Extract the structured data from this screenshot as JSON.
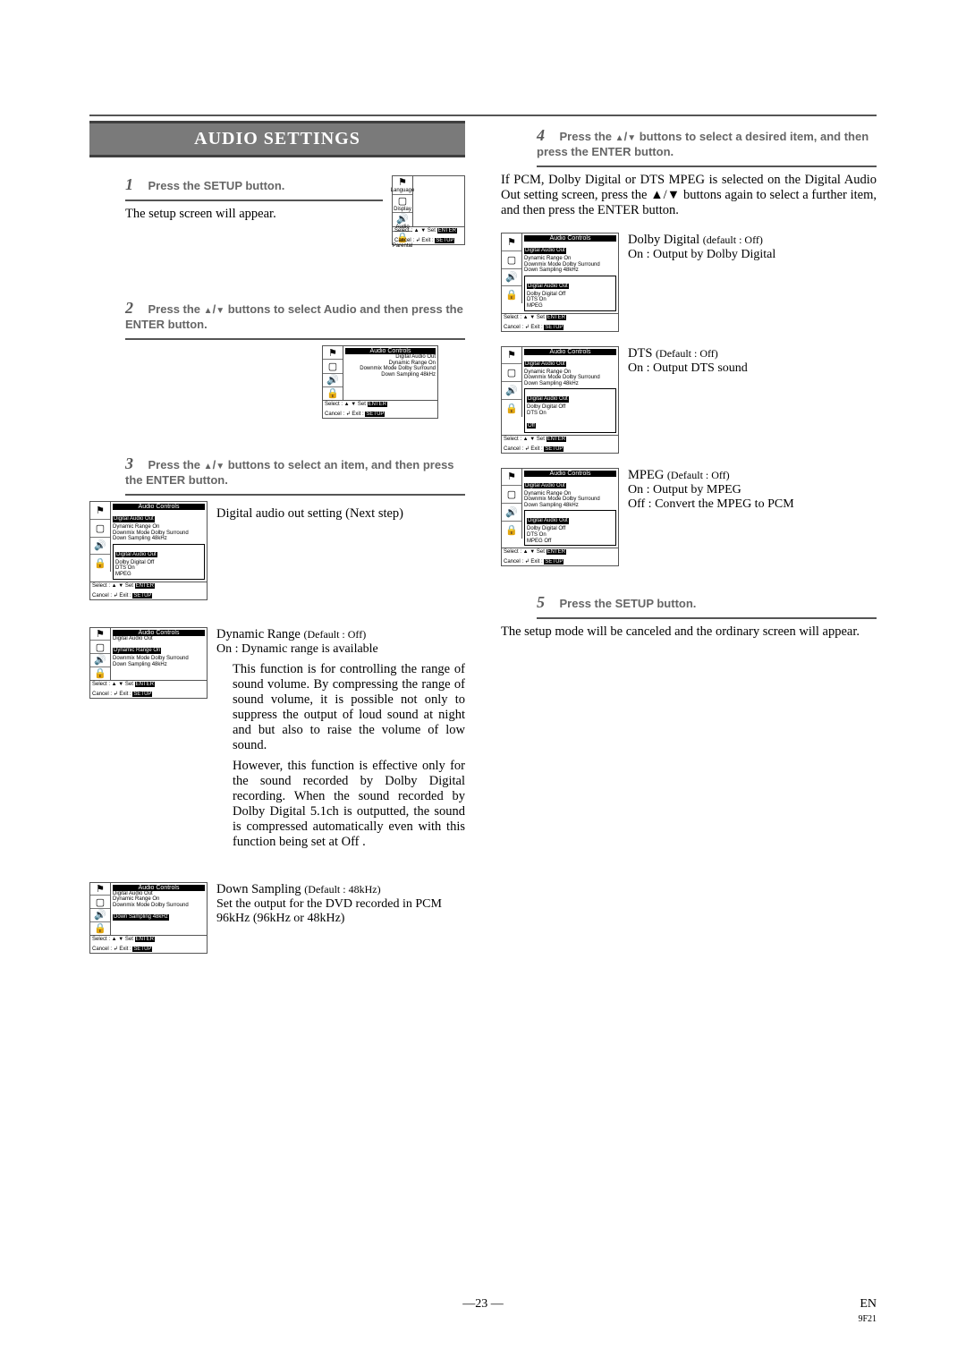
{
  "title": "AUDIO SETTINGS",
  "steps": {
    "s1": {
      "num": "1",
      "head": "Press the SETUP button.",
      "body": "The setup screen will appear."
    },
    "s2": {
      "num": "2",
      "head_a": "Press the ",
      "head_b": " buttons to select Audio and then press the ENTER button."
    },
    "s3": {
      "num": "3",
      "head_a": "Press the ",
      "head_b": " buttons to select an item, and then press the ENTER button.",
      "dao": "Digital audio out setting (Next step)",
      "dr_title": "Dynamic Range ",
      "dr_default": "(Default : Off)",
      "dr_line": "On : Dynamic range is available",
      "dr_p1": "This function is for controlling the range of sound volume.  By compressing the range of sound volume, it is possible not only to suppress the output of loud sound at night and but also to raise the volume of low sound.",
      "dr_p2": "However, this function is effective only for the sound recorded by Dolby Digital recording.  When the sound recorded by Dolby Digital 5.1ch is outputted, the sound is compressed automatically even with this function being set at  Off .",
      "ds_title": "Down Sampling ",
      "ds_default": "(Default : 48kHz)",
      "ds_line": "Set the output for the DVD recorded in PCM 96kHz (96kHz or 48kHz)"
    },
    "s4": {
      "num": "4",
      "head_a": "Press the ",
      "head_b": " buttons to select a desired item, and then press the ENTER button.",
      "intro": "If PCM, Dolby Digital or DTS MPEG is selected on the Digital Audio Out setting screen, press the ▲/▼ buttons again to select a further item, and then press the ENTER button.",
      "dd_title": "Dolby Digital ",
      "dd_default": "(default : Off)",
      "dd_line": "On : Output by Dolby Digital",
      "dts_title": "DTS ",
      "dts_default": "(Default : Off)",
      "dts_line": "On : Output DTS sound",
      "mpeg_title": "MPEG ",
      "mpeg_default": "(Default : Off)",
      "mpeg_line1": "On : Output by MPEG",
      "mpeg_line2": "Off : Convert the MPEG to PCM"
    },
    "s5": {
      "num": "5",
      "head": "Press the SETUP button.",
      "body": "The setup mode will be canceled and the ordinary screen will appear."
    }
  },
  "sidebar": {
    "language": "Language",
    "display": "Display",
    "audio": "Audio",
    "parental": "Parental"
  },
  "osd": {
    "audio_controls": "Audio Controls",
    "digital_audio_out": "Digital Audio Out",
    "dynamic_range": "Dynamic Range",
    "downmix_mode": "Downmix Mode",
    "down_sampling": "Down Sampling",
    "dolby_digital": "Dolby Digital",
    "dts": "DTS",
    "mpeg": "MPEG",
    "on": "On",
    "off": "Off",
    "dolby_surround": "Dolby Surround",
    "khz48": "48kHz",
    "select": "Select :",
    "set": "Set",
    "enter": "ENTER",
    "cancel": "Cancel :",
    "exit": "Exit :",
    "setup": "SETUP",
    "return": "↲"
  },
  "footer": {
    "page": "23",
    "en": "EN",
    "code": "9F21"
  }
}
